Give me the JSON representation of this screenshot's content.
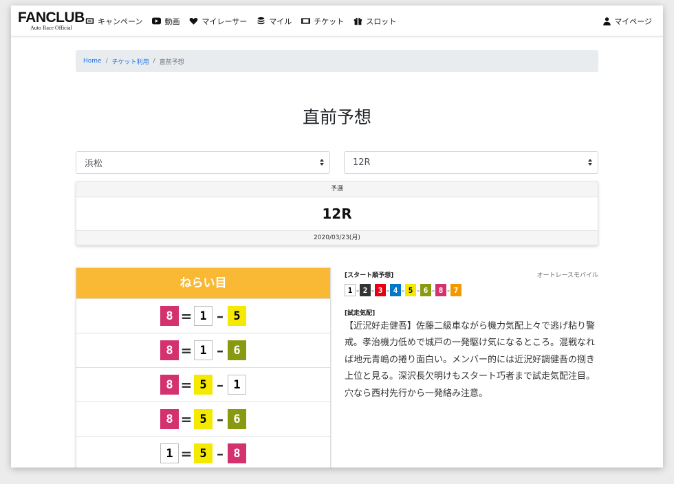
{
  "nav": {
    "logo_main": "FANCLUB",
    "logo_sub": "Auto Race Official",
    "items": [
      {
        "label": "キャンペーン",
        "icon": "ticket-card-icon"
      },
      {
        "label": "動画",
        "icon": "video-play-icon"
      },
      {
        "label": "マイレーサー",
        "icon": "heart-icon"
      },
      {
        "label": "マイル",
        "icon": "coins-icon"
      },
      {
        "label": "チケット",
        "icon": "ticket-icon"
      },
      {
        "label": "スロット",
        "icon": "gift-icon"
      }
    ],
    "mypage": {
      "label": "マイページ",
      "icon": "user-icon"
    }
  },
  "breadcrumb": [
    {
      "label": "Home"
    },
    {
      "label": "チケット利用"
    },
    {
      "label": "直前予想"
    }
  ],
  "page_title": "直前予想",
  "filters": {
    "venue": "浜松",
    "race": "12R"
  },
  "race_card": {
    "grade": "予選",
    "race": "12R",
    "date": "2020/03/23(月)"
  },
  "picks": {
    "title": "ねらい目",
    "header_color": "#f9b934",
    "rows": [
      {
        "nums": [
          "8",
          "1",
          "5"
        ],
        "ops": [
          "=",
          "–"
        ]
      },
      {
        "nums": [
          "8",
          "1",
          "6"
        ],
        "ops": [
          "=",
          "–"
        ]
      },
      {
        "nums": [
          "8",
          "5",
          "1"
        ],
        "ops": [
          "=",
          "–"
        ]
      },
      {
        "nums": [
          "8",
          "5",
          "6"
        ],
        "ops": [
          "=",
          "–"
        ]
      },
      {
        "nums": [
          "1",
          "5",
          "8"
        ],
        "ops": [
          "=",
          "–"
        ]
      }
    ]
  },
  "start_order": {
    "title": "[スタート順予想]",
    "source": "オートレースモバイル",
    "order": [
      "1",
      "2",
      "3",
      "4",
      "5",
      "6",
      "8",
      "7"
    ]
  },
  "condition": {
    "title": "[試走気配]",
    "text": "【近況好走健吾】佐藤二級車ながら機力気配上々で逃げ粘り警戒。孝治機力低めで城戸の一発駆け気になるところ。混戦なれば地元青嶋の捲り面白い。メンバー的には近況好調健吾の捌き上位と見る。深沢長欠明けもスタート巧者まで試走気配注目。穴なら西村先行から一発絡み注意。"
  },
  "car_colors": {
    "1": {
      "bg": "#ffffff",
      "fg": "#000000"
    },
    "2": {
      "bg": "#333333",
      "fg": "#ffffff"
    },
    "3": {
      "bg": "#e60012",
      "fg": "#ffffff"
    },
    "4": {
      "bg": "#0077c8",
      "fg": "#ffffff"
    },
    "5": {
      "bg": "#f5e900",
      "fg": "#000000"
    },
    "6": {
      "bg": "#8a9a10",
      "fg": "#ffffff"
    },
    "7": {
      "bg": "#f39800",
      "fg": "#ffffff"
    },
    "8": {
      "bg": "#d4326e",
      "fg": "#ffffff"
    }
  }
}
